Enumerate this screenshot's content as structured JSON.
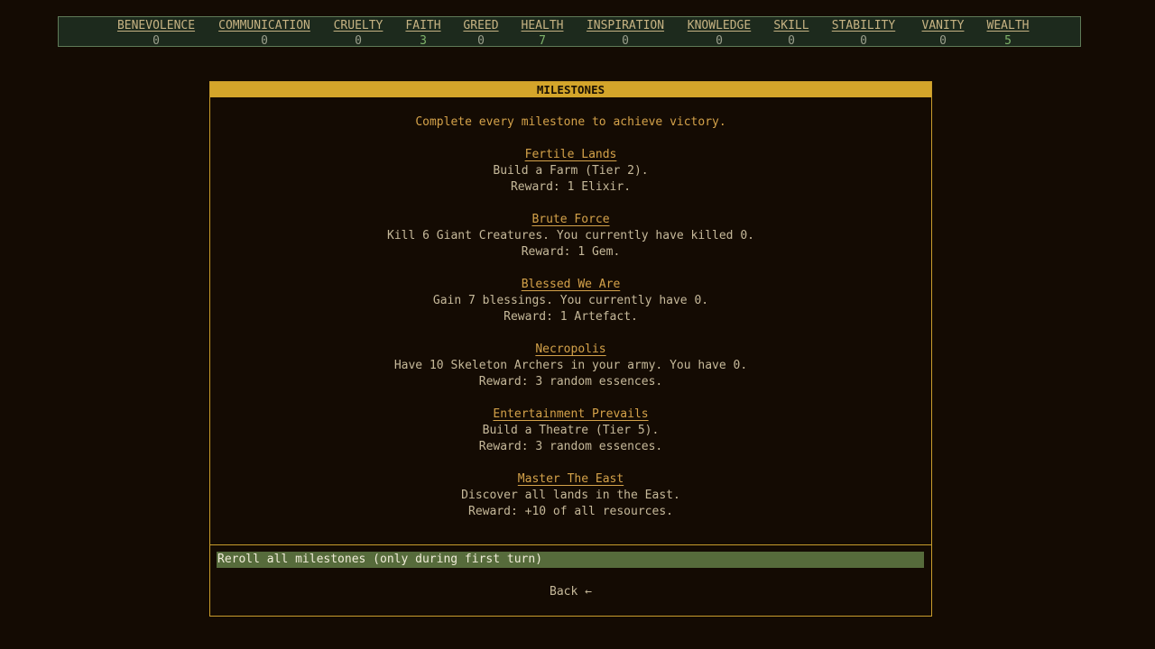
{
  "resources": [
    {
      "name": "BENEVOLENCE",
      "value": "0"
    },
    {
      "name": "COMMUNICATION",
      "value": "0"
    },
    {
      "name": "CRUELTY",
      "value": "0"
    },
    {
      "name": "FAITH",
      "value": "3"
    },
    {
      "name": "GREED",
      "value": "0"
    },
    {
      "name": "HEALTH",
      "value": "7"
    },
    {
      "name": "INSPIRATION",
      "value": "0"
    },
    {
      "name": "KNOWLEDGE",
      "value": "0"
    },
    {
      "name": "SKILL",
      "value": "0"
    },
    {
      "name": "STABILITY",
      "value": "0"
    },
    {
      "name": "VANITY",
      "value": "0"
    },
    {
      "name": "WEALTH",
      "value": "5"
    }
  ],
  "panel": {
    "title": "MILESTONES",
    "intro": "Complete every milestone to achieve victory.",
    "milestones": [
      {
        "title": "Fertile Lands",
        "description": "Build a Farm (Tier 2).",
        "reward": "Reward: 1 Elixir."
      },
      {
        "title": "Brute Force",
        "description": "Kill 6 Giant Creatures. You currently have killed 0.",
        "reward": "Reward: 1 Gem."
      },
      {
        "title": "Blessed We Are",
        "description": "Gain 7 blessings. You currently have 0.",
        "reward": "Reward: 1 Artefact."
      },
      {
        "title": "Necropolis",
        "description": "Have 10 Skeleton Archers in your army. You have 0.",
        "reward": "Reward: 3 random essences."
      },
      {
        "title": "Entertainment Prevails",
        "description": "Build a Theatre (Tier 5).",
        "reward": "Reward: 3 random essences."
      },
      {
        "title": "Master The East",
        "description": "Discover all lands in the East.",
        "reward": "Reward: +10 of all resources."
      }
    ],
    "reroll_label": "Reroll all milestones (only during first turn)",
    "back_label": "Back ←"
  },
  "colors": {
    "background": "#140b03",
    "accent": "#d4a52a",
    "positive": "#7fb36a",
    "highlight": "#566b3b"
  }
}
